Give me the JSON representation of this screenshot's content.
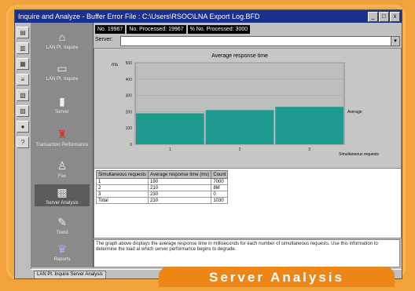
{
  "window": {
    "title": "Inquire and Analyze - Buffer Error File : C:\\Users\\RSOC\\LNA Export Log.BFD",
    "controls": [
      "_",
      "□",
      "x"
    ]
  },
  "status_cells": [
    "No. 19967",
    "No. Processed: 19967",
    "% No. Processed: 3000"
  ],
  "server": {
    "label": "Server:",
    "value": ""
  },
  "sidebar": {
    "items": [
      {
        "label": "LAN Pt. Inquire",
        "icon": "network-icon"
      },
      {
        "label": "LAN Pt. Inquire",
        "icon": "computer-icon"
      },
      {
        "label": "Server",
        "icon": "server-icon"
      },
      {
        "label": "Transaction Performance",
        "icon": "vehicle-icon"
      },
      {
        "label": "Fax",
        "icon": "person-icon"
      },
      {
        "label": "Server Analysis",
        "icon": "analysis-icon"
      },
      {
        "label": "Trend",
        "icon": "trend-icon"
      },
      {
        "label": "Reports",
        "icon": "report-icon"
      }
    ]
  },
  "chart_data": {
    "type": "bar",
    "title": "Average response time",
    "ylabel": "ms",
    "xlabel": "Simultaneous requests",
    "categories": [
      "1",
      "2",
      "3"
    ],
    "series": [
      {
        "name": "Average",
        "values": [
          190,
          210,
          230
        ]
      }
    ],
    "ylim": [
      0,
      500
    ],
    "yticks": [
      0,
      100,
      200,
      300,
      400,
      500
    ],
    "grid": true,
    "legend": "right",
    "bar_color": "#1f9a8f"
  },
  "table": {
    "columns": [
      "Simultaneous requests",
      "Average response time (ms)",
      "Count"
    ],
    "rows": [
      [
        "1",
        "190",
        "7000"
      ],
      [
        "2",
        "210",
        "8M"
      ],
      [
        "3",
        "230",
        "0"
      ],
      [
        "Total",
        "210",
        "1030"
      ]
    ]
  },
  "description": "The graph above displays the average response time in milliseconds for each number of simultaneous requests. Use this information to determine the load at which server performance begins to degrade.",
  "bottom_tab": "LAN Pt. Inquire Server Analysis",
  "caption": "Server Analysis"
}
